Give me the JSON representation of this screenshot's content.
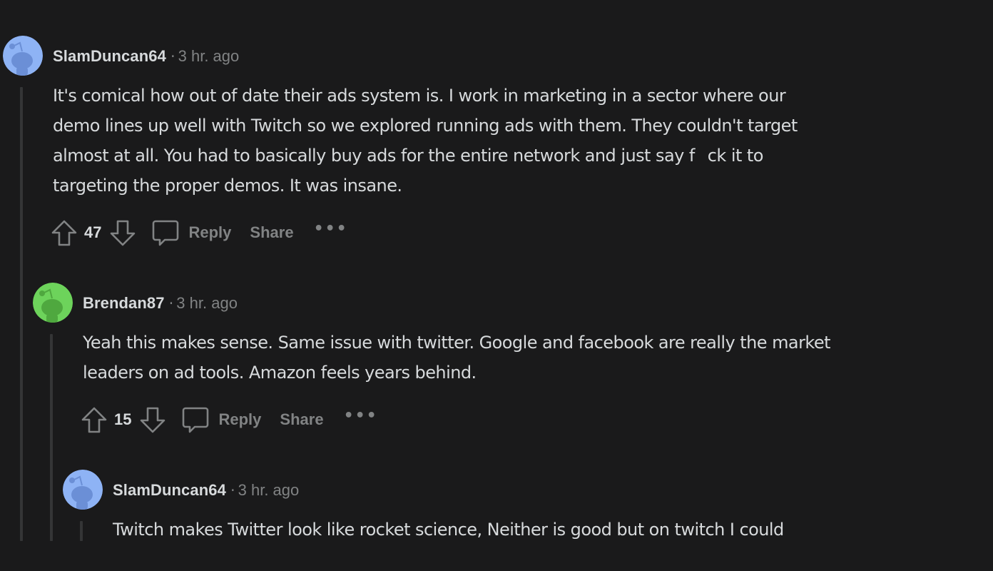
{
  "comments": [
    {
      "username": "SlamDuncan64",
      "separator": "·",
      "time": "3 hr. ago",
      "avatar_color": "#8eb3f5",
      "avatar_accent": "#6b8fd6",
      "lines": [
        "It's comical how out of date their ads system is. I work in marketing in a sector where our",
        "demo lines up well with Twitch so we explored running ads with them. They couldn't target",
        "almost at all. You had to basically buy ads for the entire network and just say f",
        "ck it to",
        "targeting the proper demos. It was insane."
      ],
      "votes": "47",
      "reply_label": "Reply",
      "share_label": "Share",
      "more_label": "•••"
    },
    {
      "username": "Brendan87",
      "separator": "·",
      "time": "3 hr. ago",
      "avatar_color": "#6dd35b",
      "avatar_accent": "#4fa83f",
      "lines": [
        "Yeah this makes sense. Same issue with twitter. Google and facebook are really the market",
        "leaders on ad tools. Amazon feels years behind."
      ],
      "votes": "15",
      "reply_label": "Reply",
      "share_label": "Share",
      "more_label": "•••"
    },
    {
      "username": "SlamDuncan64",
      "separator": "·",
      "time": "3 hr. ago",
      "avatar_color": "#8eb3f5",
      "avatar_accent": "#6b8fd6",
      "lines": [
        "Twitch makes Twitter look like rocket science, Neither is good but on twitch I could"
      ]
    }
  ],
  "colors": {
    "background": "#1a1a1b",
    "text_primary": "#d7dadc",
    "text_secondary": "#818384",
    "thread_line": "#343536"
  }
}
